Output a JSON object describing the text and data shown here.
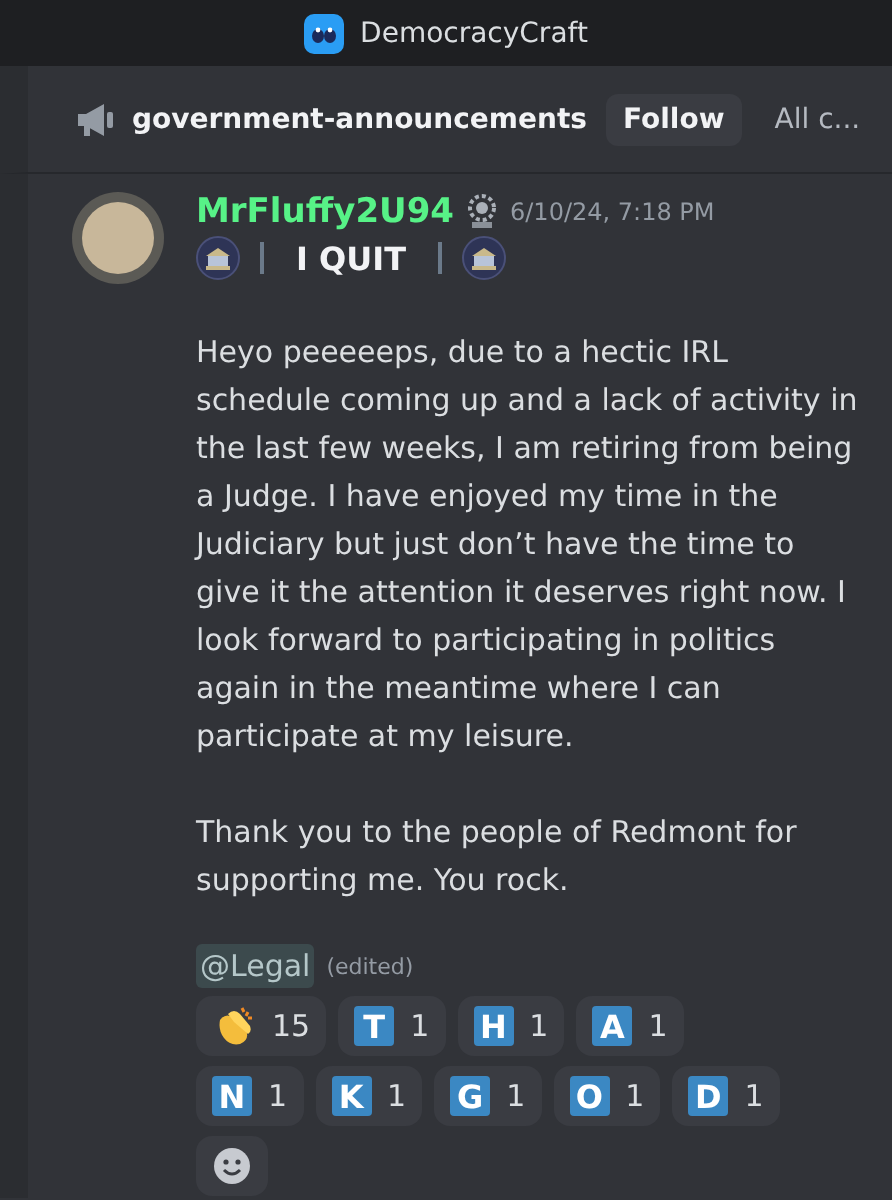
{
  "window": {
    "title": "DemocracyCraft"
  },
  "channel": {
    "name": "government-announcements",
    "follow_button": "Follow",
    "all_link": "All c..."
  },
  "message": {
    "author": "MrFluffy2U94",
    "timestamp": "6/10/24, 7:18 PM",
    "heading": "I QUIT",
    "paragraphs": [
      "Heyo peeeeeps, due to a hectic IRL schedule coming up and a lack of activity in the last few weeks, I am retiring from being a Judge. I have enjoyed my time in the Judiciary but just don’t have the time to give it the attention it deserves right now. I look forward to participating in politics again in the meantime where I can participate at my leisure.",
      "Thank you to the people of Redmont for supporting me. You rock."
    ],
    "mention": "@Legal",
    "edited": "(edited)"
  },
  "reactions": [
    {
      "kind": "clap",
      "count": "15"
    },
    {
      "kind": "letter",
      "letter": "T",
      "count": "1"
    },
    {
      "kind": "letter",
      "letter": "H",
      "count": "1"
    },
    {
      "kind": "letter",
      "letter": "A",
      "count": "1"
    },
    {
      "kind": "letter",
      "letter": "N",
      "count": "1"
    },
    {
      "kind": "letter",
      "letter": "K",
      "count": "1"
    },
    {
      "kind": "letter",
      "letter": "G",
      "count": "1"
    },
    {
      "kind": "letter",
      "letter": "O",
      "count": "1"
    },
    {
      "kind": "letter",
      "letter": "D",
      "count": "1"
    }
  ]
}
